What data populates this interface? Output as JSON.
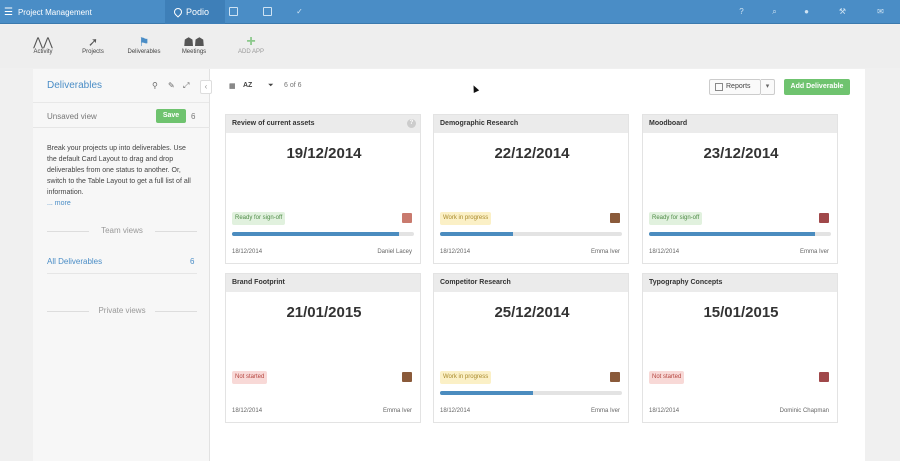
{
  "topbar": {
    "workspace": "Project Management",
    "brand": "Podio"
  },
  "apps": [
    {
      "label": "Activity",
      "icon": "activity-icon"
    },
    {
      "label": "Projects",
      "icon": "rocket-icon"
    },
    {
      "label": "Deliverables",
      "icon": "flag-icon"
    },
    {
      "label": "Meetings",
      "icon": "people-icon"
    },
    {
      "label": "ADD APP",
      "icon": "plus-icon"
    }
  ],
  "sidebar": {
    "title": "Deliverables",
    "unsaved": "Unsaved view",
    "save": "Save",
    "save_count": "6",
    "description": "Break your projects up into deliverables. Use the default Card Layout to drag and drop deliverables from one status to another. Or, switch to the Table Layout to get a full list of all information.",
    "more": "... more",
    "team_views": "Team views",
    "all_deliverables": "All Deliverables",
    "all_count": "6",
    "private_views": "Private views"
  },
  "toolbar": {
    "sort": "AZ",
    "filter_count": "6 of 6",
    "reports": "Reports",
    "add": "Add Deliverable"
  },
  "cards": [
    {
      "title": "Review of current assets",
      "date": "19/12/2014",
      "status": "Ready for sign-off",
      "status_type": "ready",
      "progress": 0.92,
      "created": "18/12/2014",
      "user": "Daniel Lacey",
      "avatar_color": "#c97a6e",
      "help": "?"
    },
    {
      "title": "Demographic Research",
      "date": "22/12/2014",
      "status": "Work in progress",
      "status_type": "wip",
      "progress": 0.4,
      "created": "18/12/2014",
      "user": "Emma Iver",
      "avatar_color": "#8a5a3a"
    },
    {
      "title": "Moodboard",
      "date": "23/12/2014",
      "status": "Ready for sign-off",
      "status_type": "ready",
      "progress": 0.91,
      "created": "18/12/2014",
      "user": "Emma Iver",
      "avatar_color": "#a0484a"
    },
    {
      "title": "Brand Footprint",
      "date": "21/01/2015",
      "status": "Not started",
      "status_type": "not",
      "progress": null,
      "created": "18/12/2014",
      "user": "Emma Iver",
      "avatar_color": "#8a5a3a"
    },
    {
      "title": "Competitor Research",
      "date": "25/12/2014",
      "status": "Work in progress",
      "status_type": "wip",
      "progress": 0.51,
      "created": "18/12/2014",
      "user": "Emma Iver",
      "avatar_color": "#8a5a3a"
    },
    {
      "title": "Typography Concepts",
      "date": "15/01/2015",
      "status": "Not started",
      "status_type": "not",
      "progress": null,
      "created": "18/12/2014",
      "user": "Dominic Chapman",
      "avatar_color": "#a0484a"
    }
  ]
}
